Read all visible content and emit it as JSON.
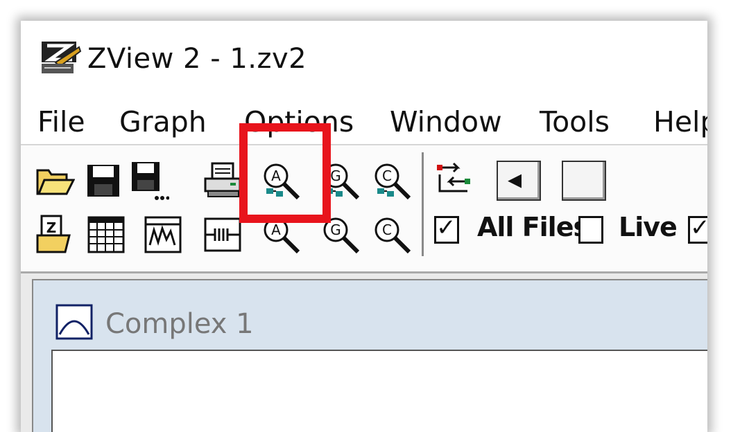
{
  "window": {
    "title": "ZView 2 - 1.zv2",
    "icon": "zview-app-icon"
  },
  "menu": {
    "items": [
      "File",
      "Graph",
      "Options",
      "Window",
      "Tools",
      "Help"
    ]
  },
  "toolbar": {
    "row1": [
      {
        "name": "open-folder-icon",
        "icon": "open-folder"
      },
      {
        "name": "save-icon",
        "icon": "floppy-disk"
      },
      {
        "name": "save-as-icon",
        "icon": "floppy-disk-dots"
      },
      {
        "name": "printer-icon",
        "icon": "printer"
      },
      {
        "name": "zoom-a-connected-icon",
        "icon": "magnifier-a-link"
      },
      {
        "name": "zoom-g-connected-icon",
        "icon": "magnifier-g-link"
      },
      {
        "name": "zoom-c-connected-icon",
        "icon": "magnifier-c-link"
      }
    ],
    "row2": [
      {
        "name": "open-z-file-icon",
        "icon": "folder-z"
      },
      {
        "name": "data-grid-icon",
        "icon": "grid"
      },
      {
        "name": "waveform-icon",
        "icon": "waveform"
      },
      {
        "name": "circuit-icon",
        "icon": "circuit"
      },
      {
        "name": "zoom-a-icon",
        "icon": "magnifier-a"
      },
      {
        "name": "zoom-g-icon",
        "icon": "magnifier-g"
      },
      {
        "name": "zoom-c-icon",
        "icon": "magnifier-c"
      }
    ],
    "sync_icon": "sync-arrows-icon",
    "nav_prev_glyph": "◂",
    "checkboxes": [
      {
        "label": "All Files",
        "checked": true,
        "check_glyph": "✓"
      },
      {
        "label": "Live",
        "checked": false,
        "check_glyph": ""
      },
      {
        "label": "",
        "checked": true,
        "check_glyph": "✓"
      }
    ]
  },
  "mdi": {
    "child_title": "Complex 1",
    "child_icon": "complex-plot-icon"
  },
  "colors": {
    "highlight": "#e8141c",
    "mdi_caption": "#d8e3ee",
    "icon_teal": "#1a8a8a"
  }
}
